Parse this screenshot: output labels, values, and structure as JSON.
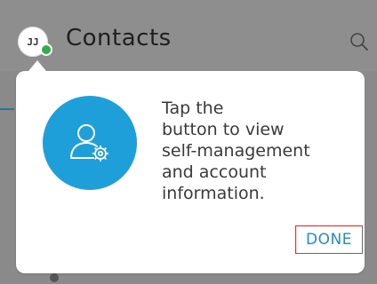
{
  "header": {
    "avatar_initials": "JJ",
    "title": "Contacts",
    "search_icon": "search-icon",
    "presence_color": "#2db04c"
  },
  "coachmark": {
    "icon": "user-settings-icon",
    "accent_color": "#1e9fd9",
    "message": "Tap the\nbutton to view\nself-management\nand account\ninformation.",
    "done_label": "DONE"
  }
}
